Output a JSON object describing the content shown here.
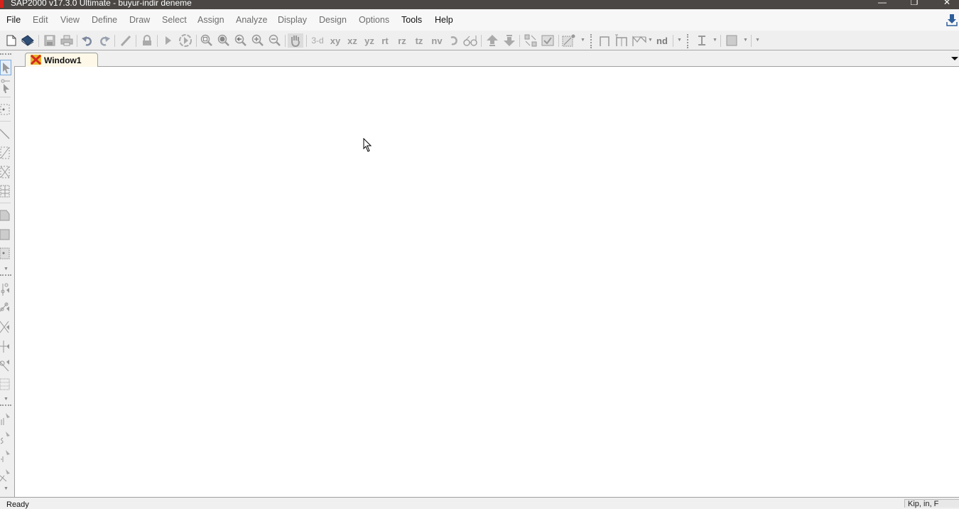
{
  "window": {
    "title": "SAP2000 v17.3.0 Ultimate  - buyur-indir deneme",
    "controls": {
      "minimize": "—",
      "restore": "❐",
      "close": "✕"
    }
  },
  "menubar": {
    "items": [
      {
        "label": "File",
        "emphasis": true
      },
      {
        "label": "Edit",
        "emphasis": false
      },
      {
        "label": "View",
        "emphasis": false
      },
      {
        "label": "Define",
        "emphasis": false
      },
      {
        "label": "Draw",
        "emphasis": false
      },
      {
        "label": "Select",
        "emphasis": false
      },
      {
        "label": "Assign",
        "emphasis": false
      },
      {
        "label": "Analyze",
        "emphasis": false
      },
      {
        "label": "Display",
        "emphasis": false
      },
      {
        "label": "Design",
        "emphasis": false
      },
      {
        "label": "Options",
        "emphasis": false
      },
      {
        "label": "Tools",
        "emphasis": true
      },
      {
        "label": "Help",
        "emphasis": true
      }
    ],
    "download_icon": "download-icon"
  },
  "toolbar": {
    "view_buttons": {
      "three_d": "3-d",
      "xy": "xy",
      "xz": "xz",
      "yz": "yz",
      "rt": "rt",
      "rz": "rz",
      "tz": "tz",
      "nv": "nv"
    },
    "nd_label": "nd",
    "icons": [
      "new-model",
      "open",
      "save",
      "print",
      "undo",
      "redo",
      "edit-pencil",
      "lock",
      "run-analysis",
      "run-now",
      "zoom-window",
      "zoom-full",
      "zoom-previous",
      "zoom-in",
      "zoom-out",
      "pan",
      "rotate-3d",
      "perspective",
      "move-up",
      "move-down",
      "show-all",
      "check",
      "display-options",
      "frame",
      "portal",
      "truss",
      "section-I",
      "area-shade"
    ]
  },
  "tabs": [
    {
      "label": "Window1",
      "active": true,
      "icon": "sap-model-icon"
    }
  ],
  "sidebar": {
    "tools": [
      "pointer",
      "reshape-pointer",
      "draw-joint",
      "draw-frame",
      "quick-frame-region",
      "quick-frame-cross",
      "draw-frame-grid",
      "draw-poly-area",
      "draw-rect-area",
      "quick-area",
      "draw-link",
      "draw-two-joint-link",
      "quick-brace",
      "draw-constraint",
      "draw-section-cut",
      "draw-solid",
      "select-pointer-1",
      "select-pointer-2",
      "select-pointer-3",
      "select-pointer-4"
    ]
  },
  "status": {
    "text": "Ready",
    "units": "Kip, in, F"
  }
}
